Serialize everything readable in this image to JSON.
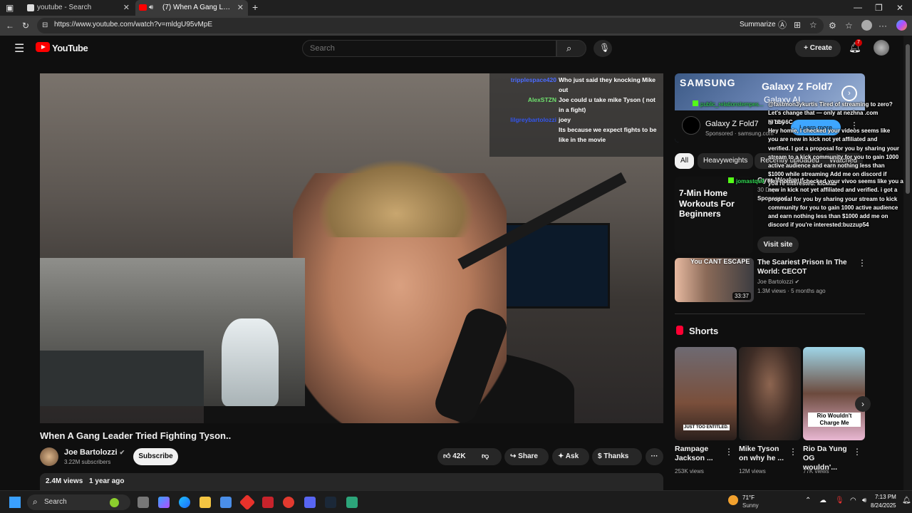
{
  "browser": {
    "tabs": [
      {
        "label": "youtube - Search",
        "active": false
      },
      {
        "label": "(7) When A Gang Leader Tried ...",
        "active": true
      }
    ],
    "url": "https://www.youtube.com/watch?v=mldgU95vMpE",
    "summarize_label": "Summarize"
  },
  "youtube": {
    "logo_text": "YouTube",
    "search_placeholder": "Search",
    "create_label": "Create",
    "notification_count": "7"
  },
  "video": {
    "title": "When A Gang Leader Tried Fighting Tyson..",
    "channel": "Joe Bartolozzi",
    "subscribers": "3.22M subscribers",
    "subscribe_label": "Subscribe",
    "likes": "42K",
    "share_label": "Share",
    "ask_label": "Ask",
    "thanks_label": "Thanks",
    "views": "2.4M views",
    "age": "1 year ago",
    "chat": [
      {
        "user": "tripplespace420",
        "message": "Who just said they knocking Mike",
        "color": "#4b6bff"
      },
      {
        "user": "",
        "message": "out",
        "color": "#ffffff"
      },
      {
        "user": "AlexSTZN",
        "message": "Joe could u take mike Tyson ( not",
        "color": "#6fe36f"
      },
      {
        "user": "",
        "message": "in a fight)",
        "color": "#ffffff"
      },
      {
        "user": "lilgreybartolozzi",
        "message": "joey",
        "color": "#3355ee"
      },
      {
        "user": "",
        "message": "Its because we expect fights to be",
        "color": "#1b8f1b"
      },
      {
        "user": "",
        "message": "like in the movie",
        "color": "#ffffff"
      }
    ]
  },
  "sidebar": {
    "ad": {
      "brand": "SAMSUNG",
      "product": "Galaxy Z Fold7",
      "tagline": "Galaxy AI",
      "title": "Galaxy Z Fold7",
      "sponsored": "Sponsored · samsung.com",
      "cta": "Learn more"
    },
    "chips": [
      "All",
      "Heavyweights",
      "Recently uploaded",
      "Watched"
    ],
    "ad2": {
      "thumb_text": "7-Min Home Workouts For Beginners",
      "title": "Gym Workout",
      "meta": "30 Days",
      "sponsored": "Sponsored",
      "cta": "Visit site"
    },
    "videos": [
      {
        "title": "The Scariest Prison In The World: CECOT",
        "channel": "Joe Bartolozzi",
        "meta": "1.3M views · 5 months ago",
        "duration": "33:37",
        "thumb_text": "You CANT ESCAPE"
      }
    ],
    "shorts_label": "Shorts",
    "shorts": [
      {
        "title": "Rampage Jackson ...",
        "views": "253K views",
        "thumb_text": "JUST TOO ENTITLED."
      },
      {
        "title": "Mike Tyson on why he ...",
        "views": "12M views",
        "thumb_text": ""
      },
      {
        "title": "Rio Da Yung OG wouldn'...",
        "views": "77K views",
        "thumb_text": "Rio Wouldn't Charge Me"
      }
    ],
    "overlay_chat": [
      {
        "user": "public_relationstempes...",
        "message": "@fastmon3ykurtis Tired of streaming to zero? Let's change that — only at nezhna .com @TEG6C"
      },
      {
        "user": "",
        "message": "hi bby"
      },
      {
        "user": "",
        "message": "Hey homie, I checked your videos seems like you are new in kick not yet affiliated and verified. I got a proposal for you by sharing your stream to a kick community for you to gain 1000 active audience and earn nothing less than $1000 while streaming Add me on discord if you're interested: kicklab"
      },
      {
        "user": "jomastqs9",
        "message": "Hey homie, I checked your vivoo seems like you are new in kick not yet affiliated and verified. i got a proposal for you by sharing your stream to kick community for you to gain 1000 active audience and earn nothing less than $1000 add me on discord if you're interested:buzzup54"
      }
    ]
  },
  "taskbar": {
    "search_label": "Search",
    "weather_temp": "71°F",
    "weather_desc": "Sunny",
    "time": "7:13 PM",
    "date": "8/24/2025"
  }
}
